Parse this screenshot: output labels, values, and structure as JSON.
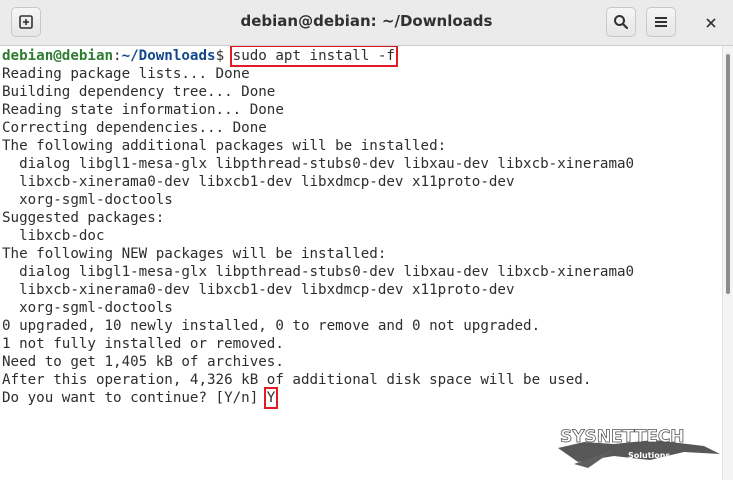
{
  "window": {
    "title": "debian@debian: ~/Downloads"
  },
  "header": {
    "new_tab_icon": "new-tab-icon",
    "search_icon": "search-icon",
    "menu_icon": "hamburger-menu-icon",
    "close_icon": "close-icon"
  },
  "terminal": {
    "prompt_user": "debian@debian",
    "prompt_separator": ":",
    "prompt_path": "~/Downloads",
    "prompt_symbol": "$ ",
    "command": "sudo apt install -f",
    "output": [
      "Reading package lists... Done",
      "Building dependency tree... Done",
      "Reading state information... Done",
      "Correcting dependencies... Done",
      "The following additional packages will be installed:",
      "  dialog libgl1-mesa-glx libpthread-stubs0-dev libxau-dev libxcb-xinerama0",
      "  libxcb-xinerama0-dev libxcb1-dev libxdmcp-dev x11proto-dev",
      "  xorg-sgml-doctools",
      "Suggested packages:",
      "  libxcb-doc",
      "The following NEW packages will be installed:",
      "  dialog libgl1-mesa-glx libpthread-stubs0-dev libxau-dev libxcb-xinerama0",
      "  libxcb-xinerama0-dev libxcb1-dev libxdmcp-dev x11proto-dev",
      "  xorg-sgml-doctools",
      "0 upgraded, 10 newly installed, 0 to remove and 0 not upgraded.",
      "1 not fully installed or removed.",
      "Need to get 1,405 kB of archives.",
      "After this operation, 4,326 kB of additional disk space will be used."
    ],
    "question": "Do you want to continue? [Y/n] ",
    "answer": "Y"
  },
  "watermark": {
    "brand": "SYSNETTECH",
    "sub": "Solutions"
  },
  "colors": {
    "highlight_box": "#e01b24",
    "prompt_user": "#2e7d32",
    "prompt_path": "#12488b"
  }
}
